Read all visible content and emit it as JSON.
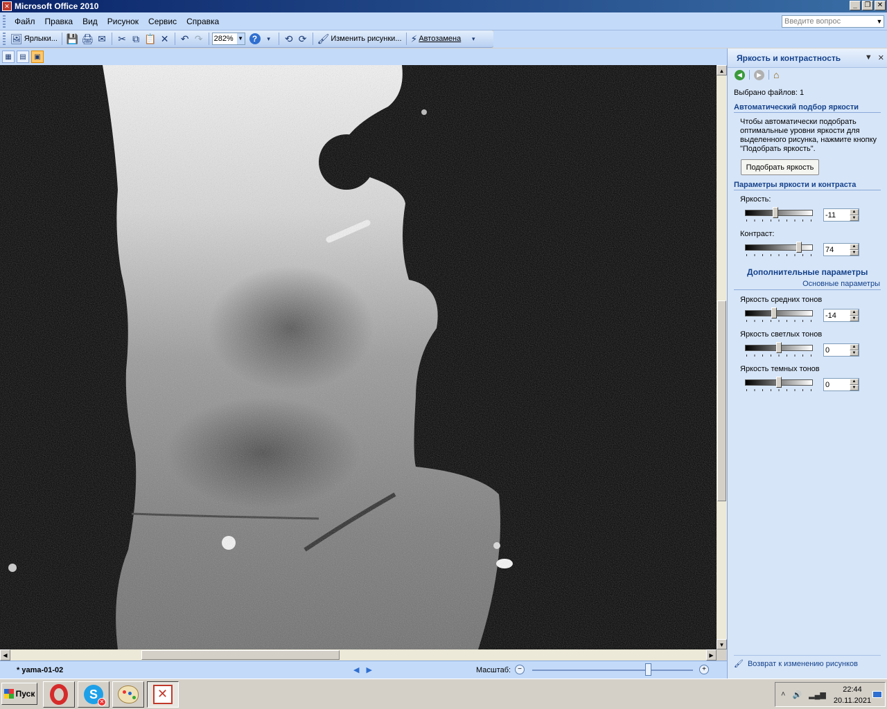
{
  "window": {
    "title": "Microsoft Office 2010"
  },
  "menu": {
    "items": [
      "Файл",
      "Правка",
      "Вид",
      "Рисунок",
      "Сервис",
      "Справка"
    ],
    "question_placeholder": "Введите вопрос"
  },
  "toolbar": {
    "shortcuts_label": "Ярлыки...",
    "zoom_value": "282%",
    "edit_pictures_label": "Изменить рисунки...",
    "autocorrect_label": "Автозамена"
  },
  "taskpane": {
    "title": "Яркость и контрастность",
    "files_selected": "Выбрано файлов: 1",
    "auto_section": "Автоматический подбор яркости",
    "auto_description": "Чтобы автоматически подобрать оптимальные уровни яркости для выделенного рисунка, нажмите кнопку \"Подобрать яркость\".",
    "auto_button": "Подобрать яркость",
    "params_section": "Параметры яркости и контраста",
    "brightness": {
      "label": "Яркость:",
      "value": "-11",
      "level": 0.44
    },
    "contrast": {
      "label": "Контраст:",
      "value": "74",
      "level": 0.82
    },
    "advanced_title": "Дополнительные параметры",
    "basic_link": "Основные параметры",
    "midtones": {
      "label": "Яркость средних тонов",
      "value": "-14",
      "level": 0.42
    },
    "highlights": {
      "label": "Яркость светлых тонов",
      "value": "0",
      "level": 0.5
    },
    "shadows": {
      "label": "Яркость темных тонов",
      "value": "0",
      "level": 0.5
    },
    "footer_link": "Возврат к изменению рисунков"
  },
  "filebar": {
    "file_name": "* yama-01-02",
    "zoom_label": "Масштаб:",
    "zoom_level": 0.72
  },
  "taskbar": {
    "start_label": "Пуск",
    "time": "22:44",
    "date": "20.11.2021"
  }
}
